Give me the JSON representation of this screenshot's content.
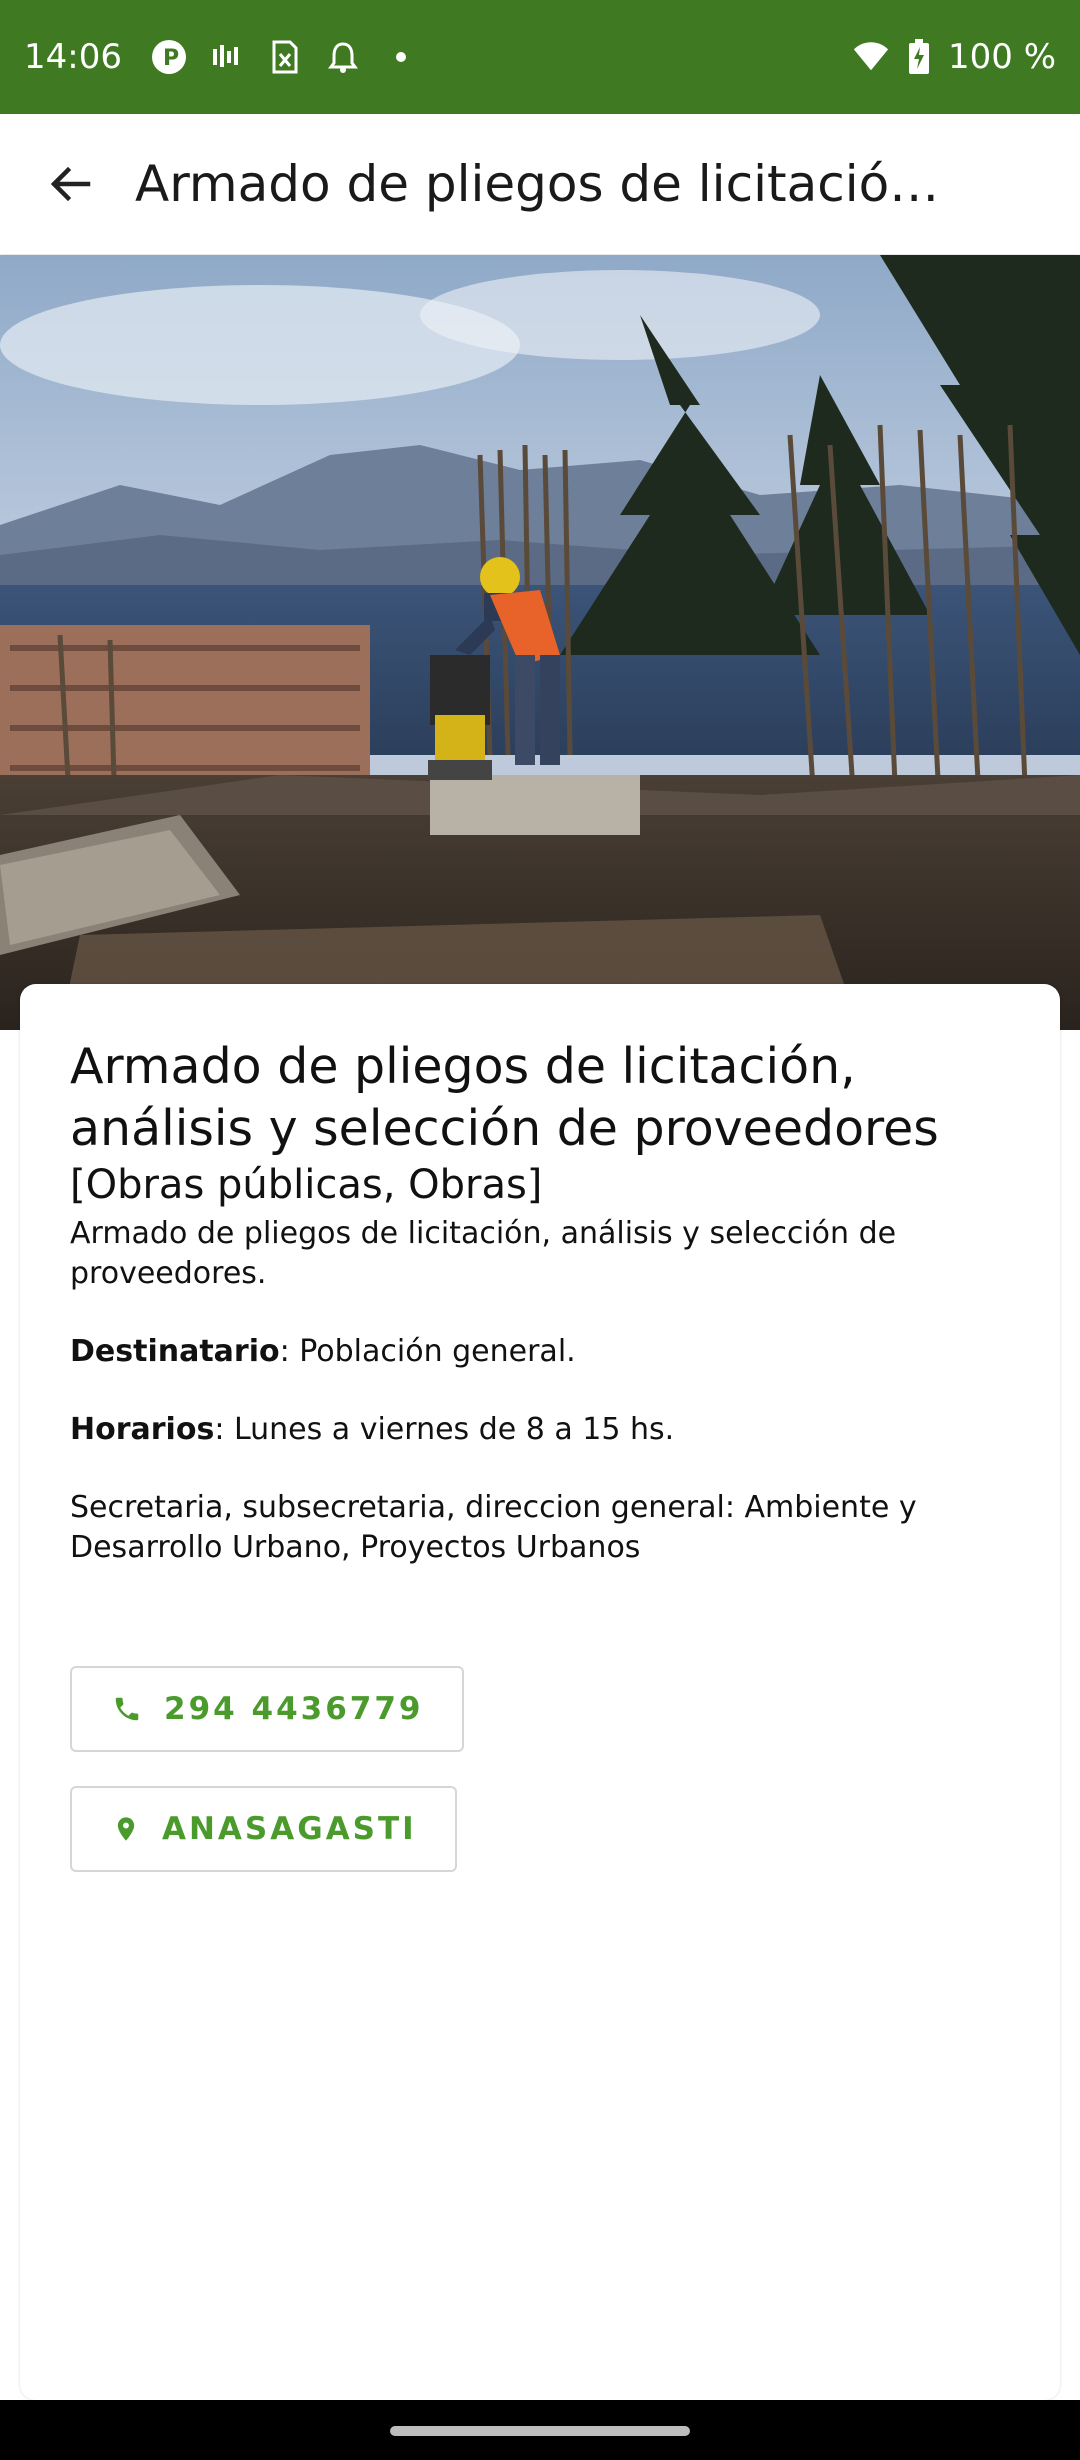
{
  "status_bar": {
    "time": "14:06",
    "battery": "100 %",
    "icons": [
      "app-p-icon",
      "signal-bars-icon",
      "sim-x-icon",
      "notification-bell-icon",
      "dot-icon",
      "wifi-icon",
      "battery-charging-icon"
    ]
  },
  "app_bar": {
    "title": "Armado de pliegos de licitació…",
    "back_icon": "arrow-back-icon"
  },
  "hero": {
    "icon": "construction-photo"
  },
  "detail": {
    "title": "Armado de pliegos de licitación, análisis y selección de proveedores",
    "categories": "[Obras públicas, Obras]",
    "description": "Armado de pliegos de licitación, análisis y selección de proveedores.",
    "destinatario_label": "Destinatario",
    "destinatario_value": ": Población general.",
    "horarios_label": "Horarios",
    "horarios_value": ": Lunes a viernes de 8 a 15 hs.",
    "secretaria": "Secretaria, subsecretaria, direccion general: Ambiente y Desarrollo Urbano, Proyectos Urbanos"
  },
  "actions": {
    "phone_label": "294 4436779",
    "place_label": "ANASAGASTI"
  },
  "colors": {
    "status_bar": "#3f7a23",
    "accent": "#4a9a2c"
  }
}
